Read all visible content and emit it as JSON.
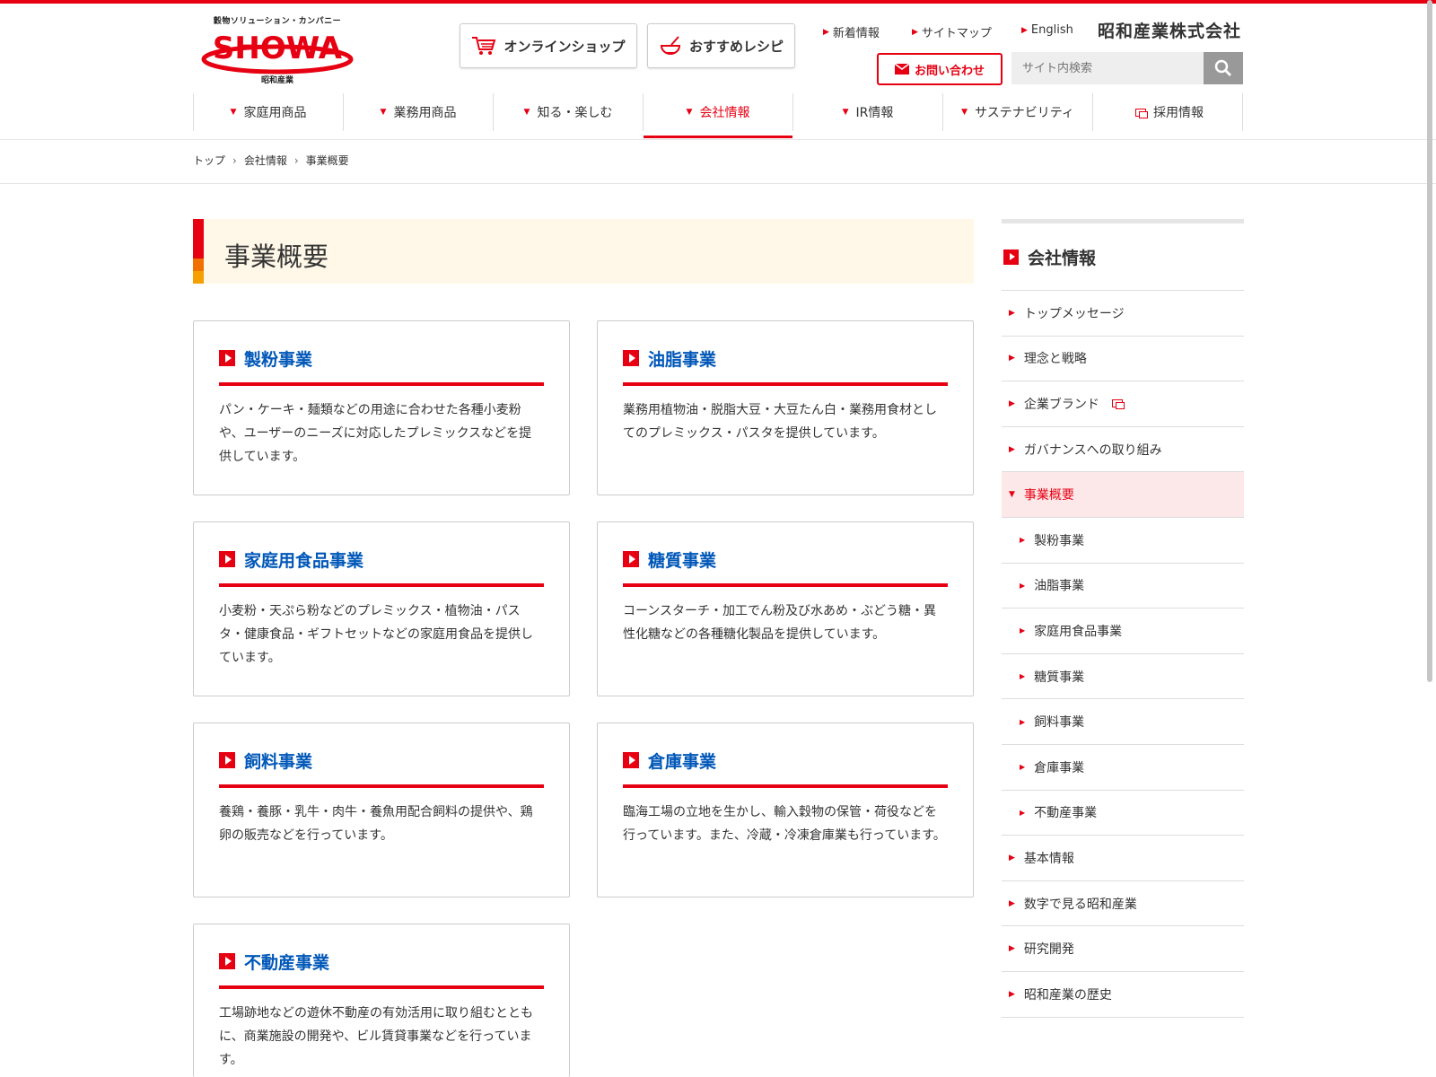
{
  "header": {
    "logo_tagline": "穀物ソリューション・カンパニー",
    "logo_text": "SHOWA",
    "logo_sub": "昭和産業",
    "shop_label": "オンラインショップ",
    "recipe_label": "おすすめレシピ",
    "links": [
      "新着情報",
      "サイトマップ",
      "English"
    ],
    "corp_name": "昭和産業株式会社",
    "contact_label": "お問い合わせ",
    "search_placeholder": "サイト内検索"
  },
  "gnav": [
    {
      "label": "家庭用商品"
    },
    {
      "label": "業務用商品"
    },
    {
      "label": "知る・楽しむ"
    },
    {
      "label": "会社情報"
    },
    {
      "label": "IR情報"
    },
    {
      "label": "サステナビリティ"
    },
    {
      "label": "採用情報"
    }
  ],
  "breadcrumb": [
    "トップ",
    "会社情報",
    "事業概要"
  ],
  "page_title": "事業概要",
  "cards": [
    {
      "title": "製粉事業",
      "body": "パン・ケーキ・麺類などの用途に合わせた各種小麦粉や、ユーザーのニーズに対応したプレミックスなどを提供しています。"
    },
    {
      "title": "油脂事業",
      "body": "業務用植物油・脱脂大豆・大豆たん白・業務用食材としてのプレミックス・パスタを提供しています。"
    },
    {
      "title": "家庭用食品事業",
      "body": "小麦粉・天ぷら粉などのプレミックス・植物油・パスタ・健康食品・ギフトセットなどの家庭用食品を提供しています。"
    },
    {
      "title": "糖質事業",
      "body": "コーンスターチ・加工でん粉及び水あめ・ぶどう糖・異性化糖などの各種糖化製品を提供しています。"
    },
    {
      "title": "飼料事業",
      "body": "養鶏・養豚・乳牛・肉牛・養魚用配合飼料の提供や、鶏卵の販売などを行っています。"
    },
    {
      "title": "倉庫事業",
      "body": "臨海工場の立地を生かし、輸入穀物の保管・荷役などを行っています。また、冷蔵・冷凍倉庫業も行っています。"
    },
    {
      "title": "不動産事業",
      "body": "工場跡地などの遊休不動産の有効活用に取り組むとともに、商業施設の開発や、ビル賃貸事業などを行っています。"
    }
  ],
  "sidebar": {
    "heading": "会社情報",
    "items": [
      {
        "label": "トップメッセージ"
      },
      {
        "label": "理念と戦略"
      },
      {
        "label": "企業ブランド"
      },
      {
        "label": "ガバナンスへの取り組み"
      },
      {
        "label": "事業概要"
      },
      {
        "label": "製粉事業"
      },
      {
        "label": "油脂事業"
      },
      {
        "label": "家庭用食品事業"
      },
      {
        "label": "糖質事業"
      },
      {
        "label": "飼料事業"
      },
      {
        "label": "倉庫事業"
      },
      {
        "label": "不動産事業"
      },
      {
        "label": "基本情報"
      },
      {
        "label": "数字で見る昭和産業"
      },
      {
        "label": "研究開発"
      },
      {
        "label": "昭和産業の歴史"
      }
    ]
  },
  "colors": {
    "brand_red": "#e60012",
    "link_blue": "#0057b8",
    "title_bg": "#fff8e8",
    "active_bg": "#fde8e9"
  }
}
